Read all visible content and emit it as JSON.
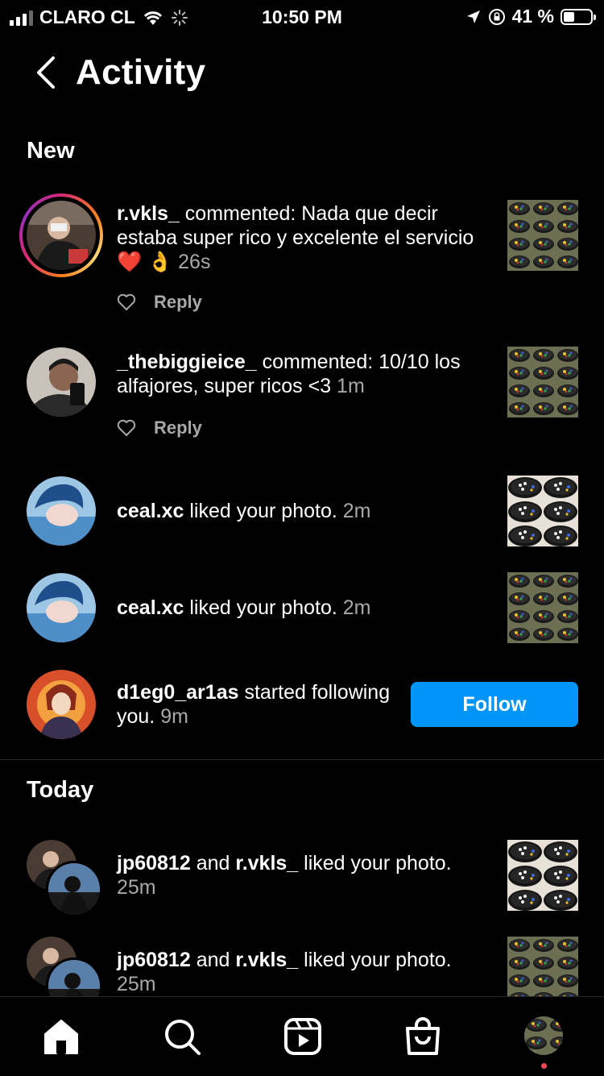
{
  "status_bar": {
    "carrier": "CLARO CL",
    "time": "10:50 PM",
    "battery": "41 %",
    "battery_level": 0.41
  },
  "header": {
    "title": "Activity"
  },
  "sections": {
    "new": "New",
    "today": "Today"
  },
  "notifications": [
    {
      "user": "r.vkls_",
      "text": " commented: Nada que decir estaba super rico y excelente el servicio ",
      "emoji": "❤️ 👌",
      "time": "26s",
      "reply": "Reply"
    },
    {
      "user": "_thebiggieice_",
      "text": " commented: 10/10 los alfajores, super ricos <3 ",
      "time": "1m",
      "reply": "Reply"
    },
    {
      "user": "ceal.xc",
      "text": " liked your photo. ",
      "time": "2m"
    },
    {
      "user": "ceal.xc",
      "text": " liked your photo. ",
      "time": "2m"
    },
    {
      "user": "d1eg0_ar1as",
      "text": " started following you. ",
      "time": "9m",
      "button": "Follow"
    }
  ],
  "today": [
    {
      "user1": "jp60812",
      "and": " and ",
      "user2": "r.vkls_",
      "text": " liked your photo. ",
      "time": "25m"
    },
    {
      "user1": "jp60812",
      "and": " and ",
      "user2": "r.vkls_",
      "text": " liked your photo. ",
      "time": "25m"
    }
  ],
  "colors": {
    "background": "#000000",
    "text": "#ffffff",
    "secondary_text": "#a8a8a8",
    "follow_button": "#0095f6",
    "notification_dot": "#ed4956"
  },
  "icons": [
    "back-chevron-icon",
    "heart-outline-icon",
    "home-icon",
    "search-icon",
    "reels-icon",
    "shop-bag-icon",
    "profile-avatar-icon"
  ]
}
